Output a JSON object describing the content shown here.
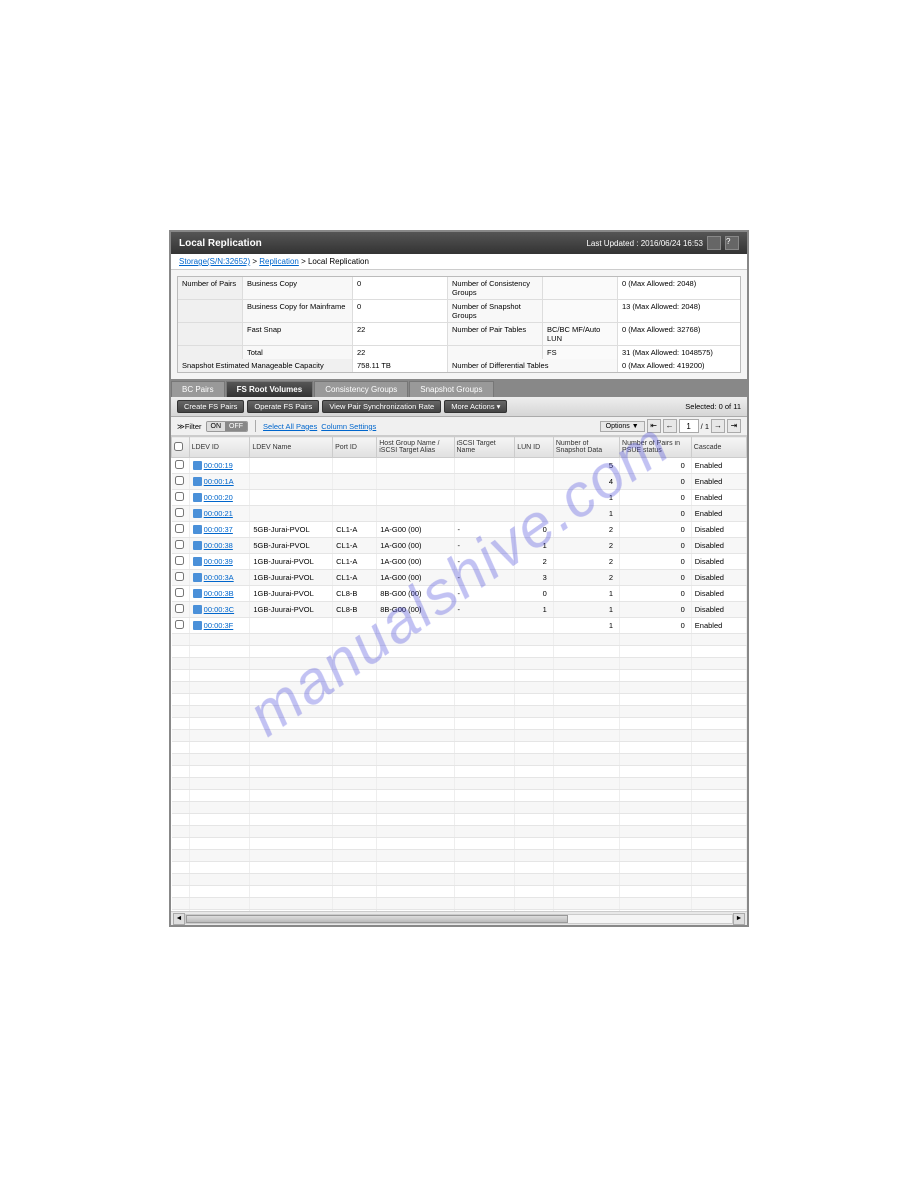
{
  "header": {
    "title": "Local Replication",
    "last_updated": "Last Updated : 2016/06/24 16:53"
  },
  "breadcrumb": {
    "storage": "Storage(S/N:32652)",
    "replication": "Replication",
    "current": "Local Replication"
  },
  "summary": {
    "pairs_label": "Number of Pairs",
    "rows": [
      {
        "l": "Business Copy",
        "v": "0",
        "l2": "Number of Consistency Groups",
        "sub": "",
        "v2": "0 (Max Allowed: 2048)"
      },
      {
        "l": "Business Copy for Mainframe",
        "v": "0",
        "l2": "Number of Snapshot Groups",
        "sub": "",
        "v2": "13 (Max Allowed: 2048)"
      },
      {
        "l": "Fast Snap",
        "v": "22",
        "l2": "Number of Pair Tables",
        "sub": "BC/BC MF/Auto LUN",
        "v2": "0 (Max Allowed: 32768)"
      },
      {
        "l": "Total",
        "v": "22",
        "l2": "",
        "sub": "FS",
        "v2": "31 (Max Allowed: 1048575)"
      }
    ],
    "capacity_label": "Snapshot Estimated Manageable Capacity",
    "capacity_val": "758.11 TB",
    "diff_label": "Number of Differential Tables",
    "diff_val": "0 (Max Allowed: 419200)"
  },
  "tabs": [
    "BC Pairs",
    "FS Root Volumes",
    "Consistency Groups",
    "Snapshot Groups"
  ],
  "toolbar": {
    "create": "Create FS Pairs",
    "operate": "Operate FS Pairs",
    "view": "View Pair Synchronization Rate",
    "more": "More Actions",
    "selected": "Selected: 0  of  11"
  },
  "filter": {
    "label": "≫Filter",
    "on": "ON",
    "off": "OFF",
    "select_all": "Select All Pages",
    "col_settings": "Column Settings",
    "options": "Options ▼",
    "page": "1",
    "total": "/ 1"
  },
  "columns": [
    "",
    "LDEV ID",
    "LDEV Name",
    "Port ID",
    "Host Group Name / iSCSI Target Alias",
    "iSCSI Target Name",
    "LUN ID",
    "Number of Snapshot Data",
    "Number of Pairs in PSUE status",
    "Cascade"
  ],
  "rows": [
    {
      "id": "00:00:19",
      "name": "",
      "port": "",
      "hg": "",
      "iscsi": "",
      "lun": "",
      "snap": "5",
      "psue": "0",
      "cascade": "Enabled"
    },
    {
      "id": "00:00:1A",
      "name": "",
      "port": "",
      "hg": "",
      "iscsi": "",
      "lun": "",
      "snap": "4",
      "psue": "0",
      "cascade": "Enabled"
    },
    {
      "id": "00:00:20",
      "name": "",
      "port": "",
      "hg": "",
      "iscsi": "",
      "lun": "",
      "snap": "1",
      "psue": "0",
      "cascade": "Enabled"
    },
    {
      "id": "00:00:21",
      "name": "",
      "port": "",
      "hg": "",
      "iscsi": "",
      "lun": "",
      "snap": "1",
      "psue": "0",
      "cascade": "Enabled"
    },
    {
      "id": "00:00:37",
      "name": "5GB-Jurai-PVOL",
      "port": "CL1-A",
      "hg": "1A-G00 (00)",
      "iscsi": "-",
      "lun": "0",
      "snap": "2",
      "psue": "0",
      "cascade": "Disabled"
    },
    {
      "id": "00:00:38",
      "name": "5GB-Jurai-PVOL",
      "port": "CL1-A",
      "hg": "1A-G00 (00)",
      "iscsi": "-",
      "lun": "1",
      "snap": "2",
      "psue": "0",
      "cascade": "Disabled"
    },
    {
      "id": "00:00:39",
      "name": "1GB-Juurai-PVOL",
      "port": "CL1-A",
      "hg": "1A-G00 (00)",
      "iscsi": "-",
      "lun": "2",
      "snap": "2",
      "psue": "0",
      "cascade": "Disabled"
    },
    {
      "id": "00:00:3A",
      "name": "1GB-Juurai-PVOL",
      "port": "CL1-A",
      "hg": "1A-G00 (00)",
      "iscsi": "-",
      "lun": "3",
      "snap": "2",
      "psue": "0",
      "cascade": "Disabled"
    },
    {
      "id": "00:00:3B",
      "name": "1GB-Juurai-PVOL",
      "port": "CL8-B",
      "hg": "8B-G00 (00)",
      "iscsi": "-",
      "lun": "0",
      "snap": "1",
      "psue": "0",
      "cascade": "Disabled"
    },
    {
      "id": "00:00:3C",
      "name": "1GB-Juurai-PVOL",
      "port": "CL8-B",
      "hg": "8B-G00 (00)",
      "iscsi": "-",
      "lun": "1",
      "snap": "1",
      "psue": "0",
      "cascade": "Disabled"
    },
    {
      "id": "00:00:3F",
      "name": "",
      "port": "",
      "hg": "",
      "iscsi": "",
      "lun": "",
      "snap": "1",
      "psue": "0",
      "cascade": "Enabled"
    }
  ],
  "watermark": "manualshive.com"
}
